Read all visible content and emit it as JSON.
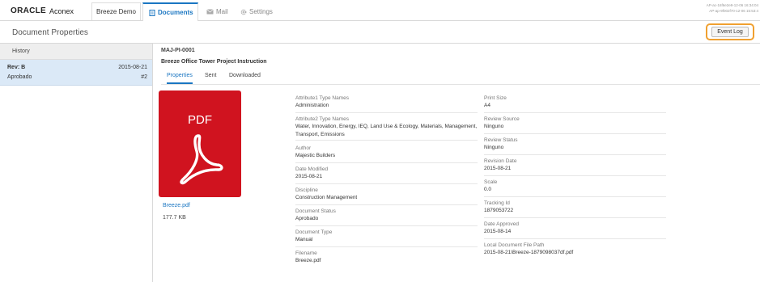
{
  "topbar": {
    "logo_brand": "ORACLE",
    "logo_product": "Aconex",
    "project": "Breeze Demo",
    "tabs": {
      "documents": "Documents",
      "mail": "Mail",
      "settings": "Settings"
    },
    "build_line1": "AP-ac-16f6e2e9-12-06 16:34:04",
    "build_line2": "AP-ap-9f002f70-12-06 15:53:4"
  },
  "header": {
    "title": "Document Properties",
    "event_log_label": "Event Log"
  },
  "sidebar": {
    "history_label": "History",
    "revision": {
      "label": "Rev: B",
      "date": "2015-08-21",
      "status": "Aprobado",
      "number": "#2"
    }
  },
  "document": {
    "number": "MAJ-PI-0001",
    "title": "Breeze Office Tower Project Instruction",
    "tabs": [
      "Properties",
      "Sent",
      "Downloaded"
    ],
    "file_type": "PDF",
    "filename_link": "Breeze.pdf",
    "file_size": "177.7 KB"
  },
  "properties_left": [
    {
      "label": "Attribute1 Type Names",
      "value": "Administration"
    },
    {
      "label": "Attribute2 Type Names",
      "value": "Water, Innovation, Energy, IEQ, Land Use & Ecology, Materials, Management, Transport, Emissions"
    },
    {
      "label": "Author",
      "value": "Majestic Builders"
    },
    {
      "label": "Date Modified",
      "value": "2015-08-21"
    },
    {
      "label": "Discipline",
      "value": "Construction Management"
    },
    {
      "label": "Document Status",
      "value": "Aprobado"
    },
    {
      "label": "Document Type",
      "value": "Manual"
    },
    {
      "label": "Filename",
      "value": "Breeze.pdf"
    }
  ],
  "properties_right": [
    {
      "label": "Print Size",
      "value": "A4"
    },
    {
      "label": "Review Source",
      "value": "Ninguno"
    },
    {
      "label": "Review Status",
      "value": "Ninguno"
    },
    {
      "label": "Revision Date",
      "value": "2015-08-21"
    },
    {
      "label": "Scale",
      "value": "0.0"
    },
    {
      "label": "Tracking Id",
      "value": "1879053722"
    },
    {
      "label": "Date Approved",
      "value": "2015-08-14"
    },
    {
      "label": "Local Document File Path",
      "value": "2015-08-21\\Breeze-1879098037df.pdf"
    }
  ],
  "colors": {
    "accent": "#1a76c2",
    "pdf_red": "#d0131f",
    "highlight_ring": "#f0a030",
    "selected_row": "#dbe9f7"
  }
}
